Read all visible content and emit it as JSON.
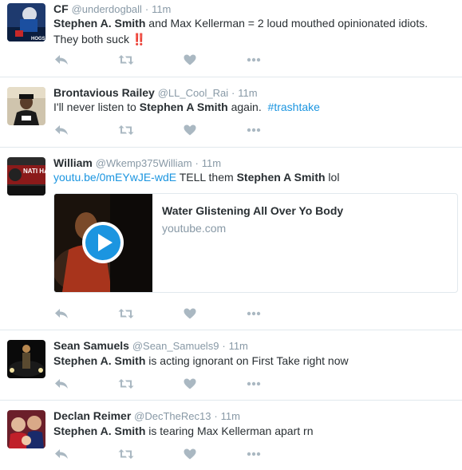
{
  "tweets": [
    {
      "fullname": "CF",
      "username": "@underdogball",
      "separator": "·",
      "time": "11m",
      "text": [
        {
          "t": "Stephen A. Smith",
          "style": "bold"
        },
        {
          "t": " and Max Kellerman = 2 loud mouthed opinionated idiots. They both suck ‼️",
          "style": "plain"
        }
      ]
    },
    {
      "fullname": "Brontavious Railey",
      "username": "@LL_Cool_Rai",
      "separator": "·",
      "time": "11m",
      "text": [
        {
          "t": "I'll never listen to ",
          "style": "plain"
        },
        {
          "t": "Stephen A Smith",
          "style": "bold"
        },
        {
          "t": " again.  ",
          "style": "plain"
        },
        {
          "t": "#trashtake",
          "style": "link"
        }
      ]
    },
    {
      "fullname": "William",
      "username": "@Wkemp375William",
      "separator": "·",
      "time": "11m",
      "text": [
        {
          "t": "youtu.be/0mEYwJE-wdE",
          "style": "link"
        },
        {
          "t": " TELL them ",
          "style": "plain"
        },
        {
          "t": "Stephen A Smith",
          "style": "bold"
        },
        {
          "t": " lol",
          "style": "plain"
        }
      ],
      "card": {
        "title": "Water Glistening All Over Yo Body",
        "domain": "youtube.com"
      }
    },
    {
      "fullname": "Sean Samuels",
      "username": "@Sean_Samuels9",
      "separator": "·",
      "time": "11m",
      "text": [
        {
          "t": "Stephen A. Smith",
          "style": "bold"
        },
        {
          "t": " is acting ignorant on First Take right now",
          "style": "plain"
        }
      ]
    },
    {
      "fullname": "Declan Reimer",
      "username": "@DecTheRec13",
      "separator": "·",
      "time": "11m",
      "text": [
        {
          "t": "Stephen A. Smith",
          "style": "bold"
        },
        {
          "t": " is tearing Max Kellerman apart rn",
          "style": "plain"
        }
      ]
    }
  ],
  "avatar_texts": {
    "tweet0": "HOGS",
    "tweet2": "NATI HAMPI"
  },
  "icons": {
    "reply": "reply-icon",
    "retweet": "retweet-icon",
    "like": "heart-icon",
    "more": "more-icon",
    "play": "play-icon"
  },
  "colors": {
    "text": "#292f33",
    "muted": "#8899a6",
    "link": "#1b95e0",
    "action_icon": "#aab8c2",
    "divider": "#e1e8ed"
  }
}
